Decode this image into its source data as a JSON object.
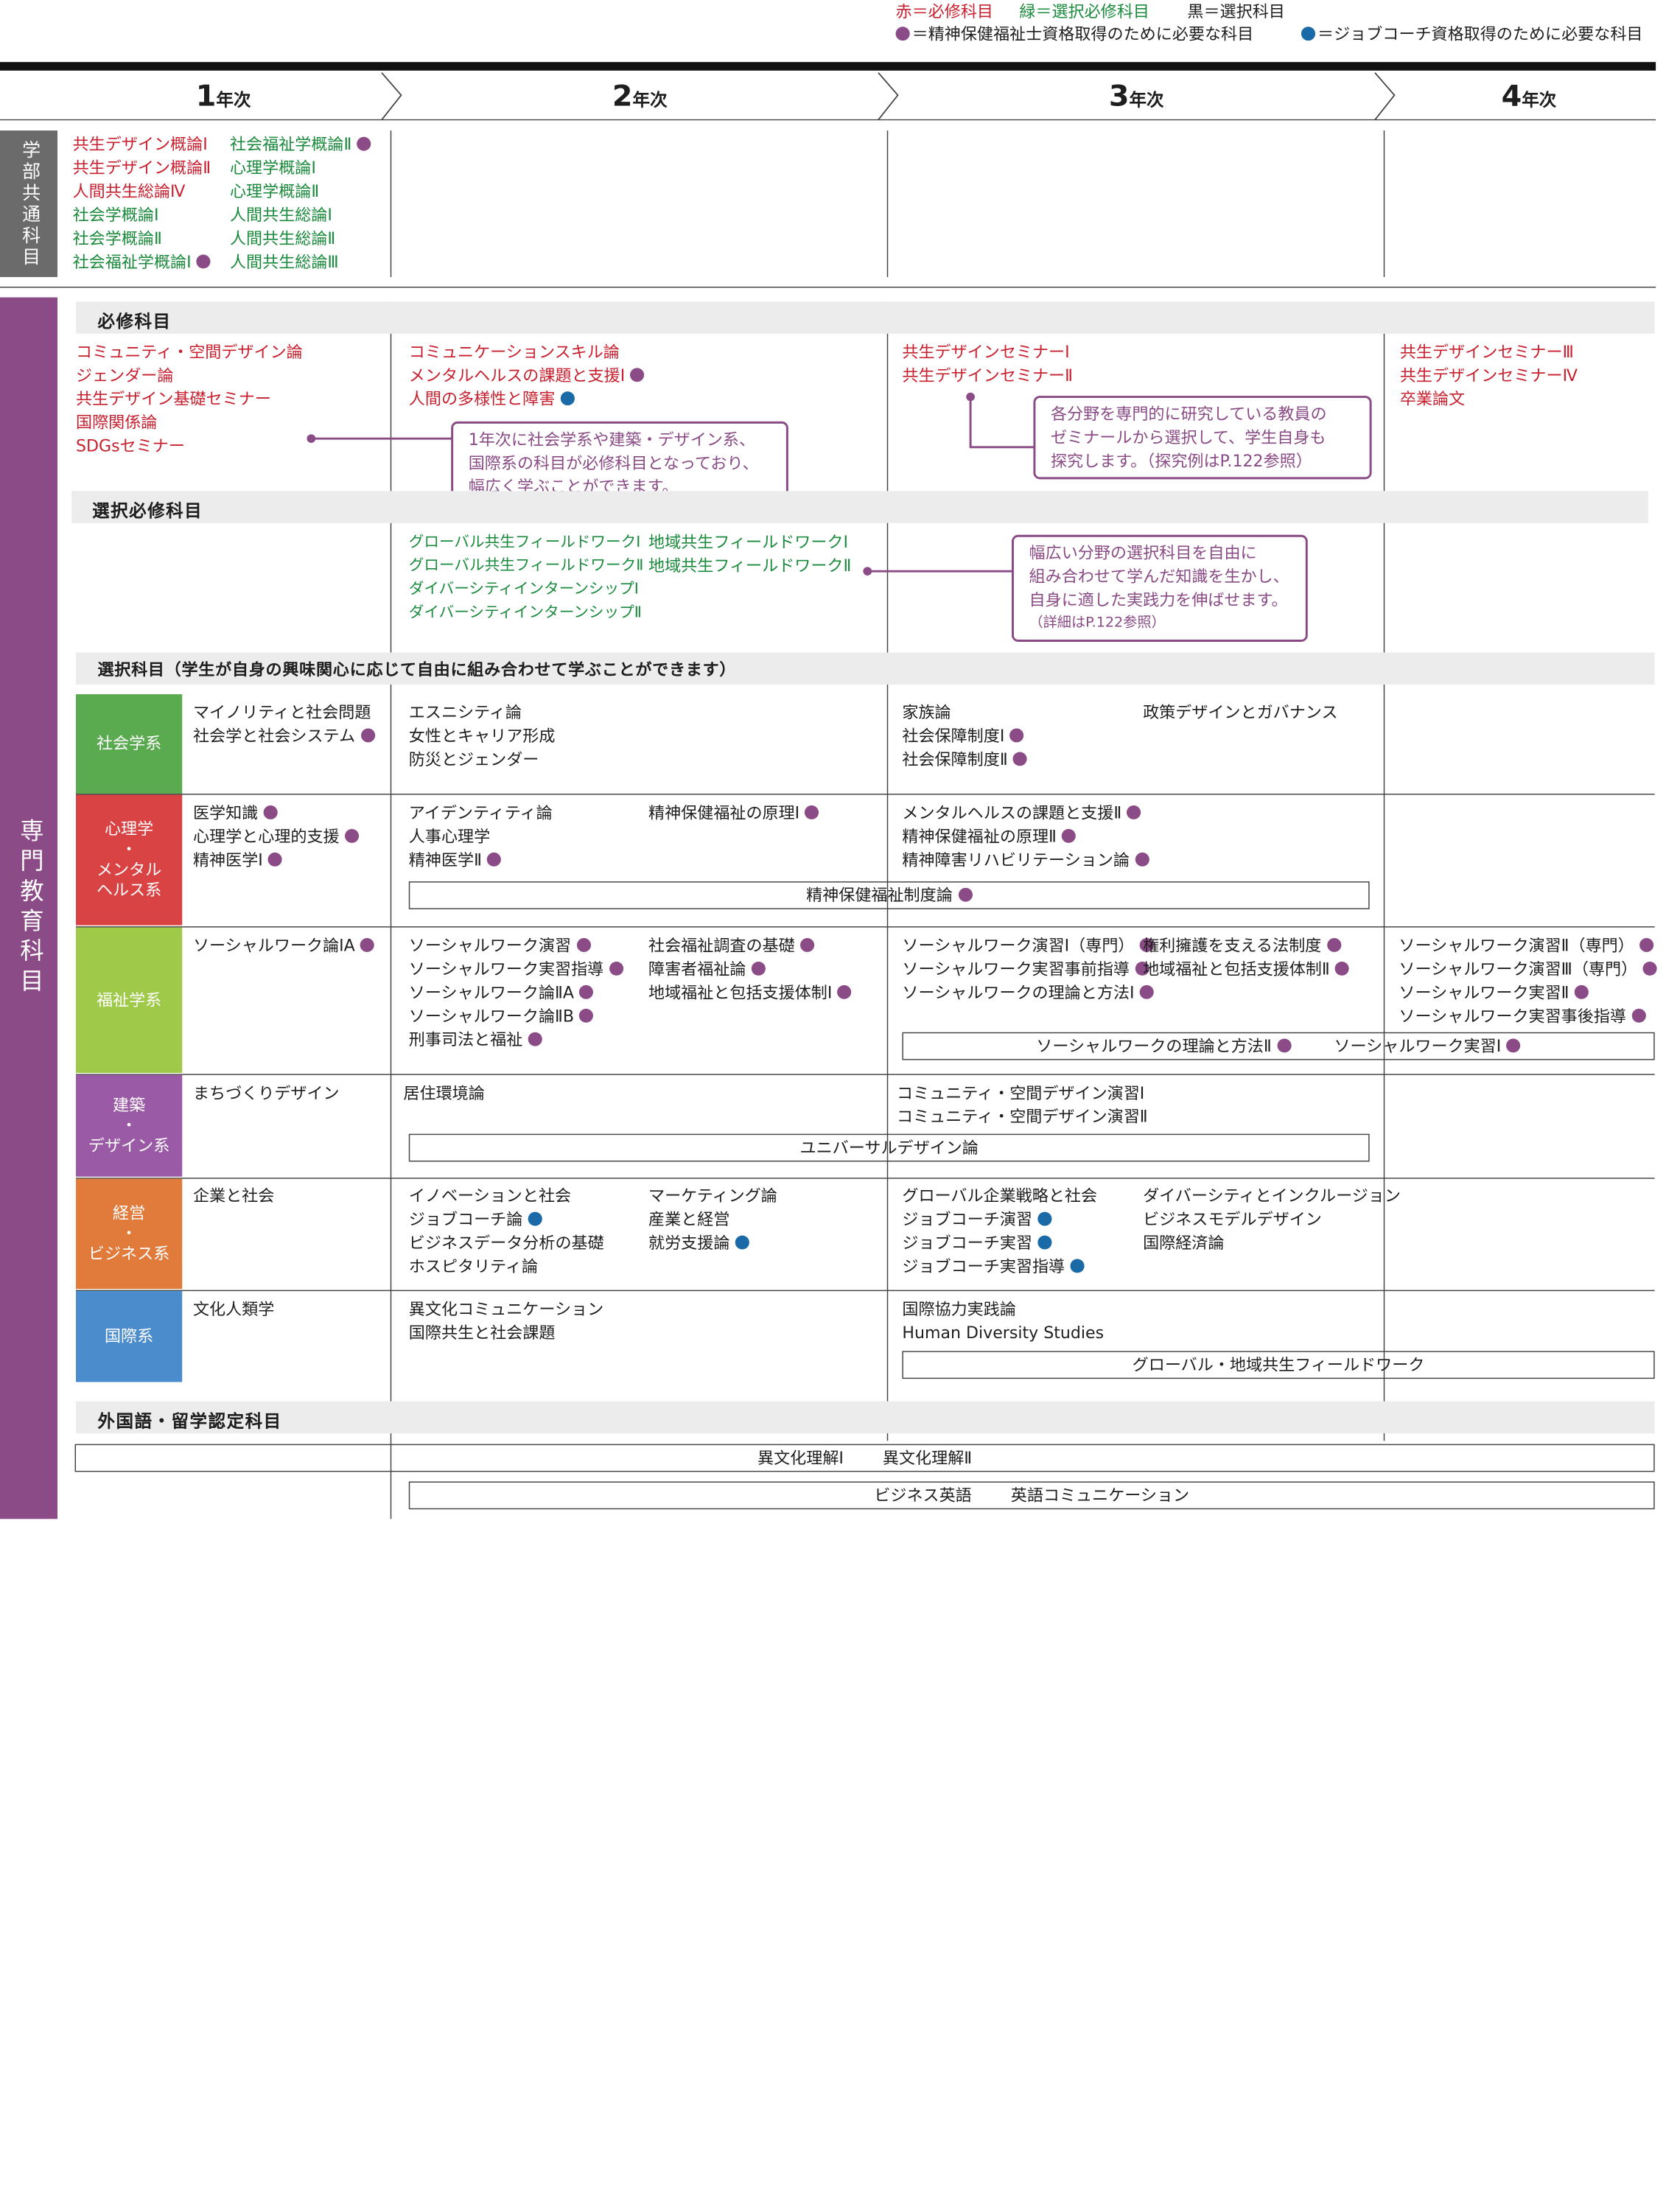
{
  "legend": {
    "red": "赤＝必修科目",
    "green": "緑＝選択必修科目",
    "black": "黒＝選択科目",
    "purple_note": "＝精神保健福祉士資格取得のために必要な科目",
    "blue_note": "＝ジョブコーチ資格取得のために必要な科目"
  },
  "colors": {
    "required": "#c8202f",
    "elective_required": "#1a8a3c",
    "purple_dot": "#8b4b86",
    "blue_dot": "#1a6aa8",
    "sociology": "#5aaa50",
    "psychology": "#d94343",
    "welfare": "#9fc948",
    "architecture": "#9b5aa6",
    "business": "#e07b3c",
    "international": "#4b8ccc",
    "sidebar_gray": "#6b6b6b",
    "sidebar_purple": "#8b4b86"
  },
  "years": [
    {
      "num": "1",
      "label": "年次"
    },
    {
      "num": "2",
      "label": "年次"
    },
    {
      "num": "3",
      "label": "年次"
    },
    {
      "num": "4",
      "label": "年次"
    }
  ],
  "side": {
    "common": "学部共通科目",
    "specialized": "専門教育科目"
  },
  "common_courses": {
    "col1": [
      "共生デザイン概論Ⅰ",
      "共生デザイン概論Ⅱ",
      "人間共生総論Ⅳ",
      "社会学概論Ⅰ",
      "社会学概論Ⅱ",
      "社会福祉学概論Ⅰ"
    ],
    "col2": [
      "社会福祉学概論Ⅱ",
      "心理学概論Ⅰ",
      "心理学概論Ⅱ",
      "人間共生総論Ⅰ",
      "人間共生総論Ⅱ",
      "人間共生総論Ⅲ"
    ]
  },
  "required": {
    "title": "必修科目",
    "y1": [
      "コミュニティ・空間デザイン論",
      "ジェンダー論",
      "共生デザイン基礎セミナー",
      "国際関係論",
      "SDGsセミナー"
    ],
    "y2": [
      "コミュニケーションスキル論",
      "メンタルヘルスの課題と支援Ⅰ",
      "人間の多様性と障害"
    ],
    "y3": [
      "共生デザインセミナーⅠ",
      "共生デザインセミナーⅡ"
    ],
    "y4": [
      "共生デザインセミナーⅢ",
      "共生デザインセミナーⅣ",
      "卒業論文"
    ],
    "note1": [
      "1年次に社会学系や建築・デザイン系、",
      "国際系の科目が必修科目となっており、",
      "幅広く学ぶことができます。"
    ],
    "note2": [
      "各分野を専門的に研究している教員の",
      "ゼミナールから選択して、学生自身も",
      "探究します。（探究例はP.122参照）"
    ]
  },
  "elective_required": {
    "title": "選択必修科目",
    "col1": [
      "グローバル共生フィールドワークⅠ",
      "グローバル共生フィールドワークⅡ",
      "ダイバーシティインターンシップⅠ",
      "ダイバーシティインターンシップⅡ"
    ],
    "col2": [
      "地域共生フィールドワークⅠ",
      "地域共生フィールドワークⅡ"
    ],
    "note": [
      "幅広い分野の選択科目を自由に",
      "組み合わせて学んだ知識を生かし、",
      "自身に適した実践力を伸ばせます。"
    ],
    "note_small": "（詳細はP.122参照）"
  },
  "elective": {
    "title": "選択科目（学生が自身の興味関心に応じて自由に組み合わせて学ぶことができます）",
    "categories": {
      "sociology": "社会学系",
      "psychology": [
        "心理学",
        "・",
        "メンタル",
        "ヘルス系"
      ],
      "welfare": "福祉学系",
      "architecture": [
        "建築",
        "・",
        "デザイン系"
      ],
      "business": [
        "経営",
        "・",
        "ビジネス系"
      ],
      "international": "国際系"
    },
    "soc": {
      "y1": [
        "マイノリティと社会問題",
        "社会学と社会システム"
      ],
      "y2": [
        "エスニシティ論",
        "女性とキャリア形成",
        "防災とジェンダー"
      ],
      "y3a": [
        "家族論",
        "社会保障制度Ⅰ",
        "社会保障制度Ⅱ"
      ],
      "y3b": [
        "政策デザインとガバナンス"
      ]
    },
    "psy": {
      "y1": [
        "医学知識",
        "心理学と心理的支援",
        "精神医学Ⅰ"
      ],
      "y2a": [
        "アイデンティティ論",
        "人事心理学",
        "精神医学Ⅱ"
      ],
      "y2b": [
        "精神保健福祉の原理Ⅰ"
      ],
      "y3": [
        "メンタルヘルスの課題と支援Ⅱ",
        "精神保健福祉の原理Ⅱ",
        "精神障害リハビリテーション論"
      ],
      "span": "精神保健福祉制度論"
    },
    "wel": {
      "y1": [
        "ソーシャルワーク論ⅠA"
      ],
      "y2a": [
        "ソーシャルワーク演習",
        "ソーシャルワーク実習指導",
        "ソーシャルワーク論ⅡA",
        "ソーシャルワーク論ⅡB",
        "刑事司法と福祉"
      ],
      "y2b": [
        "社会福祉調査の基礎",
        "障害者福祉論",
        "地域福祉と包括支援体制Ⅰ"
      ],
      "y3a": [
        "ソーシャルワーク演習Ⅰ（専門）",
        "ソーシャルワーク実習事前指導",
        "ソーシャルワークの理論と方法Ⅰ"
      ],
      "y3b": [
        "権利擁護を支える法制度",
        "地域福祉と包括支援体制Ⅱ"
      ],
      "y4": [
        "ソーシャルワーク演習Ⅱ（専門）",
        "ソーシャルワーク演習Ⅲ（専門）",
        "ソーシャルワーク実習Ⅱ",
        "ソーシャルワーク実習事後指導"
      ],
      "span1": "ソーシャルワークの理論と方法Ⅱ",
      "span2": "ソーシャルワーク実習Ⅰ"
    },
    "arc": {
      "y1": [
        "まちづくりデザイン"
      ],
      "y2": [
        "居住環境論"
      ],
      "y3": [
        "コミュニティ・空間デザイン演習Ⅰ",
        "コミュニティ・空間デザイン演習Ⅱ"
      ],
      "span": "ユニバーサルデザイン論"
    },
    "biz": {
      "y1": [
        "企業と社会"
      ],
      "y2a": [
        "イノベーションと社会",
        "ジョブコーチ論",
        "ビジネスデータ分析の基礎",
        "ホスピタリティ論"
      ],
      "y2b": [
        "マーケティング論",
        "産業と経営",
        "就労支援論"
      ],
      "y3a": [
        "グローバル企業戦略と社会",
        "ジョブコーチ演習",
        "ジョブコーチ実習",
        "ジョブコーチ実習指導"
      ],
      "y3b": [
        "ダイバーシティとインクルージョン",
        "ビジネスモデルデザイン",
        "国際経済論"
      ]
    },
    "intl": {
      "y1": [
        "文化人類学"
      ],
      "y2": [
        "異文化コミュニケーション",
        "国際共生と社会課題"
      ],
      "y3": [
        "国際協力実践論",
        "Human Diversity Studies"
      ],
      "span": "グローバル・地域共生フィールドワーク"
    }
  },
  "foreign": {
    "title": "外国語・留学認定科目",
    "row1": [
      "異文化理解Ⅰ",
      "異文化理解Ⅱ"
    ],
    "row2": [
      "ビジネス英語",
      "英語コミュニケーション"
    ]
  }
}
